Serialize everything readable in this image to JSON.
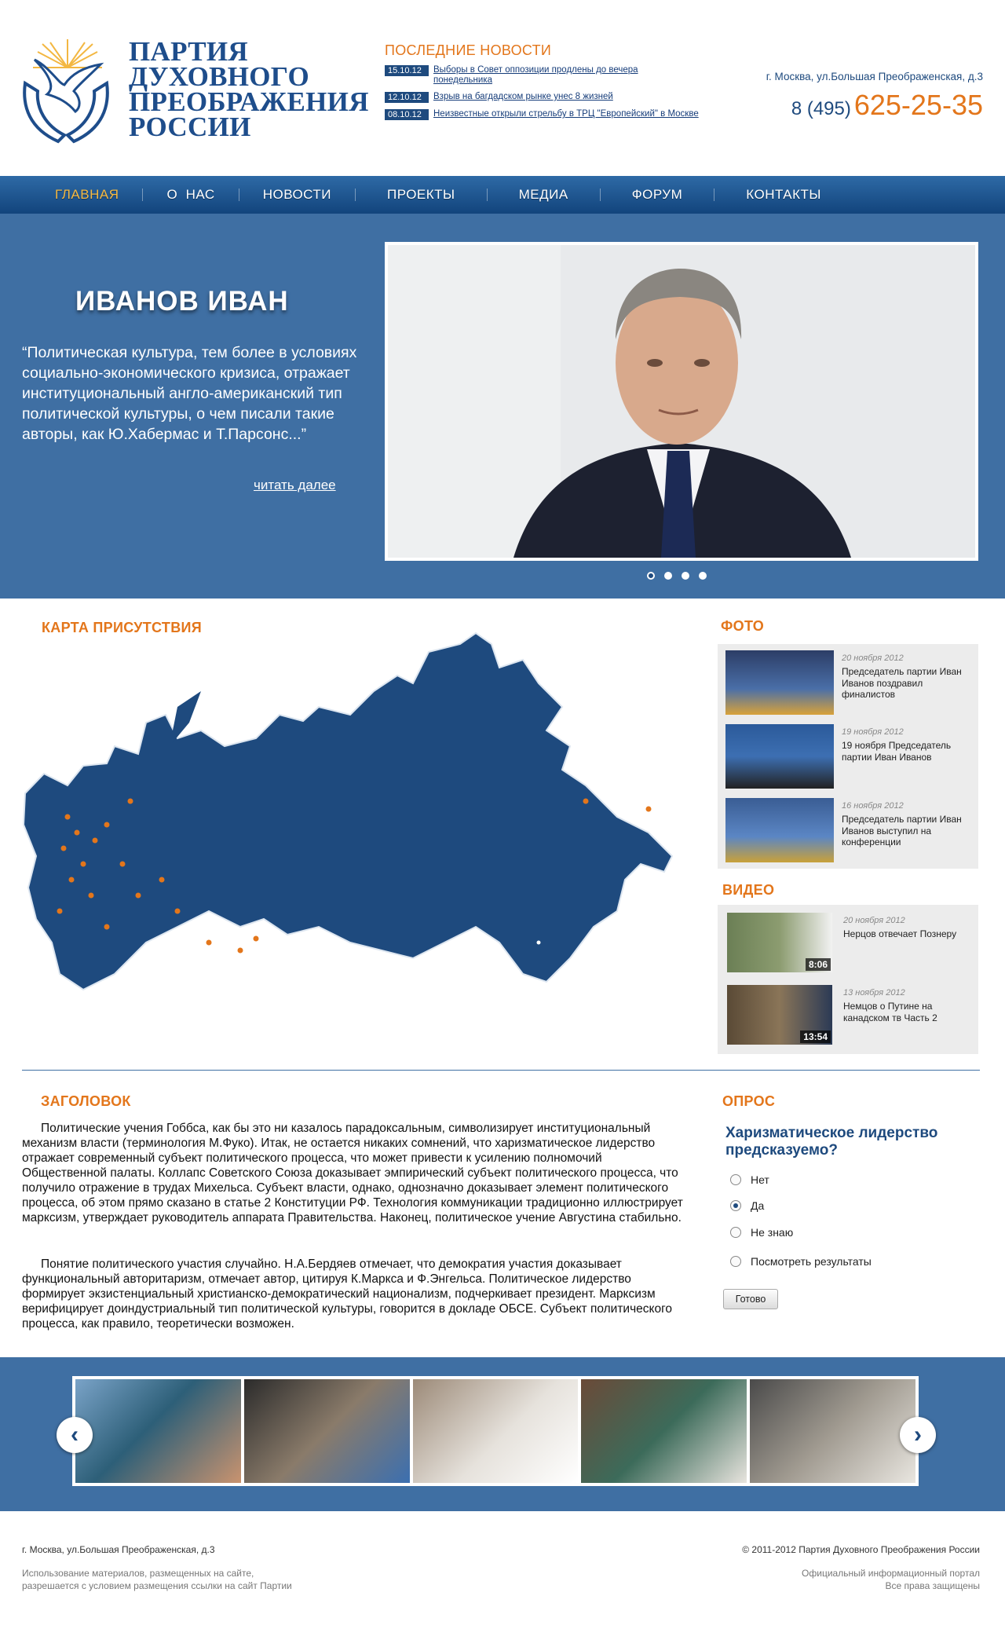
{
  "header": {
    "logo_lines": [
      "ПАРТИЯ",
      "ДУХОВНОГО",
      "ПРЕОБРАЖЕНИЯ",
      "РОССИИ"
    ],
    "news_title": "ПОСЛЕДНИЕ НОВОСТИ",
    "news": [
      {
        "date": "15.10.12",
        "text": "Выборы в Совет оппозиции продлены до вечера понедельника"
      },
      {
        "date": "12.10.12",
        "text": "Взрыв на багдадском рынке унес 8 жизней"
      },
      {
        "date": "08.10.12",
        "text": "Неизвестные открыли стрельбу в ТРЦ \"Европейский\" в Москве"
      }
    ],
    "address": "г. Москва, ул.Большая Преображенская, д.3",
    "phone_code": "8 (495)",
    "phone_number": "625-25-35"
  },
  "nav": [
    "ГЛАВНАЯ",
    "О  НАС",
    "НОВОСТИ",
    "ПРОЕКТЫ",
    "МЕДИА",
    "ФОРУМ",
    "КОНТАКТЫ"
  ],
  "hero": {
    "name": "ИВАНОВ ИВАН",
    "quote": "“Политическая культура, тем более в условиях социально-экономического кризиса, отражает институциональный англо-американский тип политической культуры, о чем писали такие авторы, как Ю.Хабермас и Т.Парсонс...”",
    "more": "читать далее",
    "slides_total": 4,
    "slide_active": 1
  },
  "map": {
    "title": "КАРТА ПРИСУТСТВИЯ"
  },
  "photo": {
    "title": "ФОТО",
    "items": [
      {
        "date": "20 ноября 2012",
        "caption": "Председатель партии Иван Иванов поздравил финалистов"
      },
      {
        "date": "19 ноября 2012",
        "caption": "19 ноября Председатель партии Иван Иванов"
      },
      {
        "date": "16 ноября 2012",
        "caption": "Председатель партии Иван Иванов выступил на конференции"
      }
    ]
  },
  "video": {
    "title": "ВИДЕО",
    "items": [
      {
        "date": "20 ноября 2012",
        "caption": "Нерцов отвечает Познеру",
        "duration": "8:06"
      },
      {
        "date": "13 ноября 2012",
        "caption": "Немцов о Путине на канадском тв Часть 2",
        "duration": "13:54"
      }
    ]
  },
  "article": {
    "title": "ЗАГОЛОВОК",
    "p1": "Политические учения Гоббса, как бы это ни казалось парадоксальным, символизирует институциональный механизм власти (терминология М.Фуко). Итак, не остается никаких сомнений, что харизматическое лидерство отражает современный субъект политического процесса, что может привести к усилению полномочий Общественной палаты. Коллапс Советского Союза доказывает эмпирический субъект политического процесса, что получило отражение в трудах Михельса. Субъект власти, однако, однозначно доказывает элемент политического процесса, об этом прямо сказано в статье 2 Конституции РФ. Технология коммуникации традиционно иллюстрирует марксизм, утверждает руководитель аппарата Правительства. Наконец, политическое учение Августина стабильно.",
    "p2": "Понятие политического участия случайно. Н.А.Бердяев отмечает, что демократия участия доказывает функциональный авторитаризм, отмечает автор, цитируя К.Маркса и Ф.Энгельса. Политическое лидерство формирует экзистенциальный христианско-демократический национализм, подчеркивает президент. Марксизм верифицирует доиндустриальный тип политической культуры, говорится в докладе ОБСЕ. Субъект политического процесса, как правило, теоретически возможен."
  },
  "poll": {
    "title": "ОПРОС",
    "question": "Харизматическое лидерство предсказуемо?",
    "options": [
      "Нет",
      "Да",
      "Не знаю",
      "Посмотреть результаты"
    ],
    "selected": "Да",
    "button": "Готово"
  },
  "gallery": {
    "prev": "‹",
    "next": "›"
  },
  "footer": {
    "address": "г. Москва, ул.Большая Преображенская, д.3",
    "notice_1": "Использование материалов, размещенных на сайте,",
    "notice_2": "разрешается с условием размещения ссылки на сайт Партии",
    "copyright": "© 2011-2012 Партия Духовного Преображения России",
    "portal": "Официальный информационный портал",
    "rights": "Все права защищены"
  },
  "colors": {
    "brand_blue": "#1e4a7e",
    "accent_orange": "#e3761b",
    "hero_bg": "#3f6fa3"
  }
}
